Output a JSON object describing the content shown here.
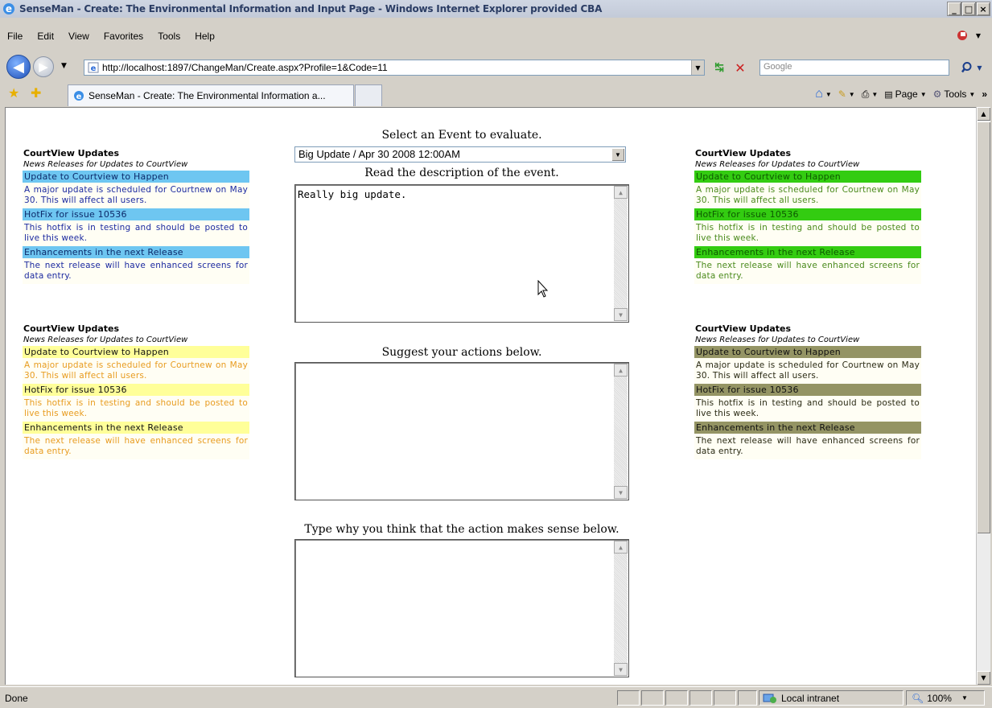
{
  "window": {
    "title": "SenseMan - Create: The Environmental Information and Input Page - Windows Internet Explorer provided CBA",
    "minimize": "_",
    "maximize": "□",
    "close": "×"
  },
  "menu": [
    "File",
    "Edit",
    "View",
    "Favorites",
    "Tools",
    "Help"
  ],
  "address": {
    "url": "http://localhost:1897/ChangeMan/Create.aspx?Profile=1&Code=11",
    "search_placeholder": "Google"
  },
  "tab": {
    "label": "SenseMan - Create: The Environmental Information a..."
  },
  "command_bar": {
    "page": "Page",
    "tools": "Tools"
  },
  "panels": {
    "heading": "CourtView Updates",
    "subheading": "News Releases for Updates to CourtView",
    "items": [
      {
        "title": "Update to Courtview to Happen",
        "desc": "A major update is scheduled for Courtnew on May 30. This will affect all users."
      },
      {
        "title": "HotFix for issue 10536",
        "desc": "This hotfix is in testing and should be posted to live this week."
      },
      {
        "title": "Enhancements in the next Release",
        "desc": "The next release will have enhanced screens for data entry."
      }
    ]
  },
  "form": {
    "select_label": "Select an Event to evaluate.",
    "selected_event": "Big Update / Apr 30 2008 12:00AM",
    "description_label": "Read the description of the event.",
    "description_text": "Really big update.",
    "actions_label": "Suggest your actions below.",
    "actions_text": "",
    "reason_label": "Type why you think that the action makes sense below.",
    "reason_text": ""
  },
  "status": {
    "text": "Done",
    "zone": "Local intranet",
    "zoom": "100%"
  },
  "colors": {
    "blue_title": "#6ec6f1",
    "yellow_title": "#ffff99",
    "green_title": "#33cc11",
    "olive_title": "#949464"
  }
}
